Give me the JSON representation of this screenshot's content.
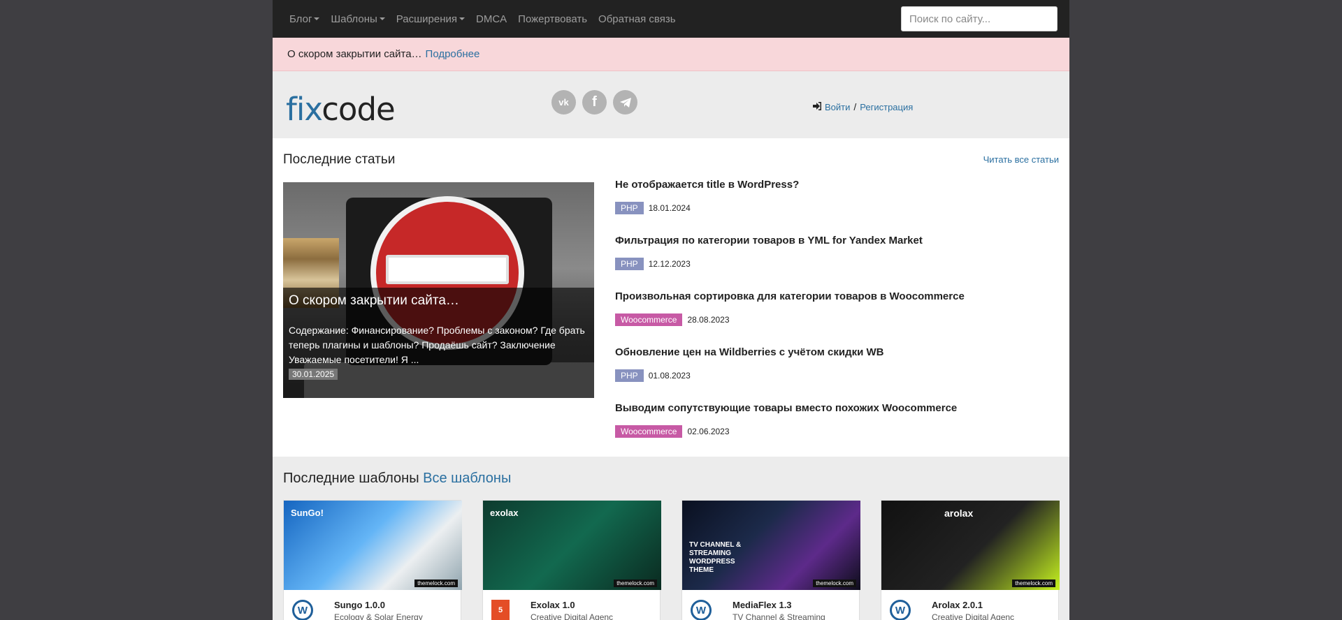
{
  "nav": {
    "items": [
      "Блог",
      "Шаблоны",
      "Расширения",
      "DMCA",
      "Пожертвовать",
      "Обратная связь"
    ],
    "search_placeholder": "Поиск по сайту..."
  },
  "alert": {
    "text": "О скором закрытии сайта…",
    "link": "Подробнее"
  },
  "header": {
    "logo_fix": "fix",
    "logo_code": "code",
    "socials": [
      "vk-icon",
      "facebook-icon",
      "telegram-icon"
    ],
    "login": "Войти",
    "separator": "/",
    "register": "Регистрация"
  },
  "posts": {
    "heading": "Последние статьи",
    "read_all": "Читать все статьи",
    "featured": {
      "title": "О скором закрытии сайта…",
      "excerpt": "Содержание: Финансирование? Проблемы с законом? Где брать теперь плагины и шаблоны? Продаёшь сайт? Заключение Уважаемые посетители! Я ...",
      "date": "30.01.2025"
    },
    "items": [
      {
        "title": "Не отображается title в WordPress?",
        "tag": "PHP",
        "date": "18.01.2024"
      },
      {
        "title": "Фильтрация по категории товаров в YML for Yandex Market",
        "tag": "PHP",
        "date": "12.12.2023"
      },
      {
        "title": "Произвольная сортировка для категории товаров в Woocommerce",
        "tag": "Woocommerce",
        "date": "28.08.2023"
      },
      {
        "title": "Обновление цен на Wildberries с учётом скидки WB",
        "tag": "PHP",
        "date": "01.08.2023"
      },
      {
        "title": "Выводим сопутствующие товары вместо похожих Woocommerce",
        "tag": "Woocommerce",
        "date": "02.06.2023"
      }
    ]
  },
  "templates": {
    "heading": "Последние шаблоны",
    "all_link": "Все шаблоны",
    "items": [
      {
        "name": "Sungo 1.0.0",
        "desc": "Ecology & Solar Energy",
        "icon": "wordpress-icon",
        "thumb_text": "SunGo!"
      },
      {
        "name": "Exolax 1.0",
        "desc": "Creative Digital Agenc",
        "icon": "html5-icon",
        "thumb_text": "exolax"
      },
      {
        "name": "MediaFlex 1.3",
        "desc": "TV Channel & Streaming",
        "icon": "wordpress-icon",
        "thumb_text": "TV CHANNEL & STREAMING WORDPRESS THEME"
      },
      {
        "name": "Arolax 2.0.1",
        "desc": "Creative Digital Agenc",
        "icon": "wordpress-icon",
        "thumb_text": "arolax"
      }
    ],
    "thumb_stamp": "themelock.com"
  },
  "colors": {
    "accent": "#2a6fa0",
    "php_tag": "#8892bf",
    "woo_tag": "#c75aa5",
    "alert_bg": "#f8d7da"
  }
}
